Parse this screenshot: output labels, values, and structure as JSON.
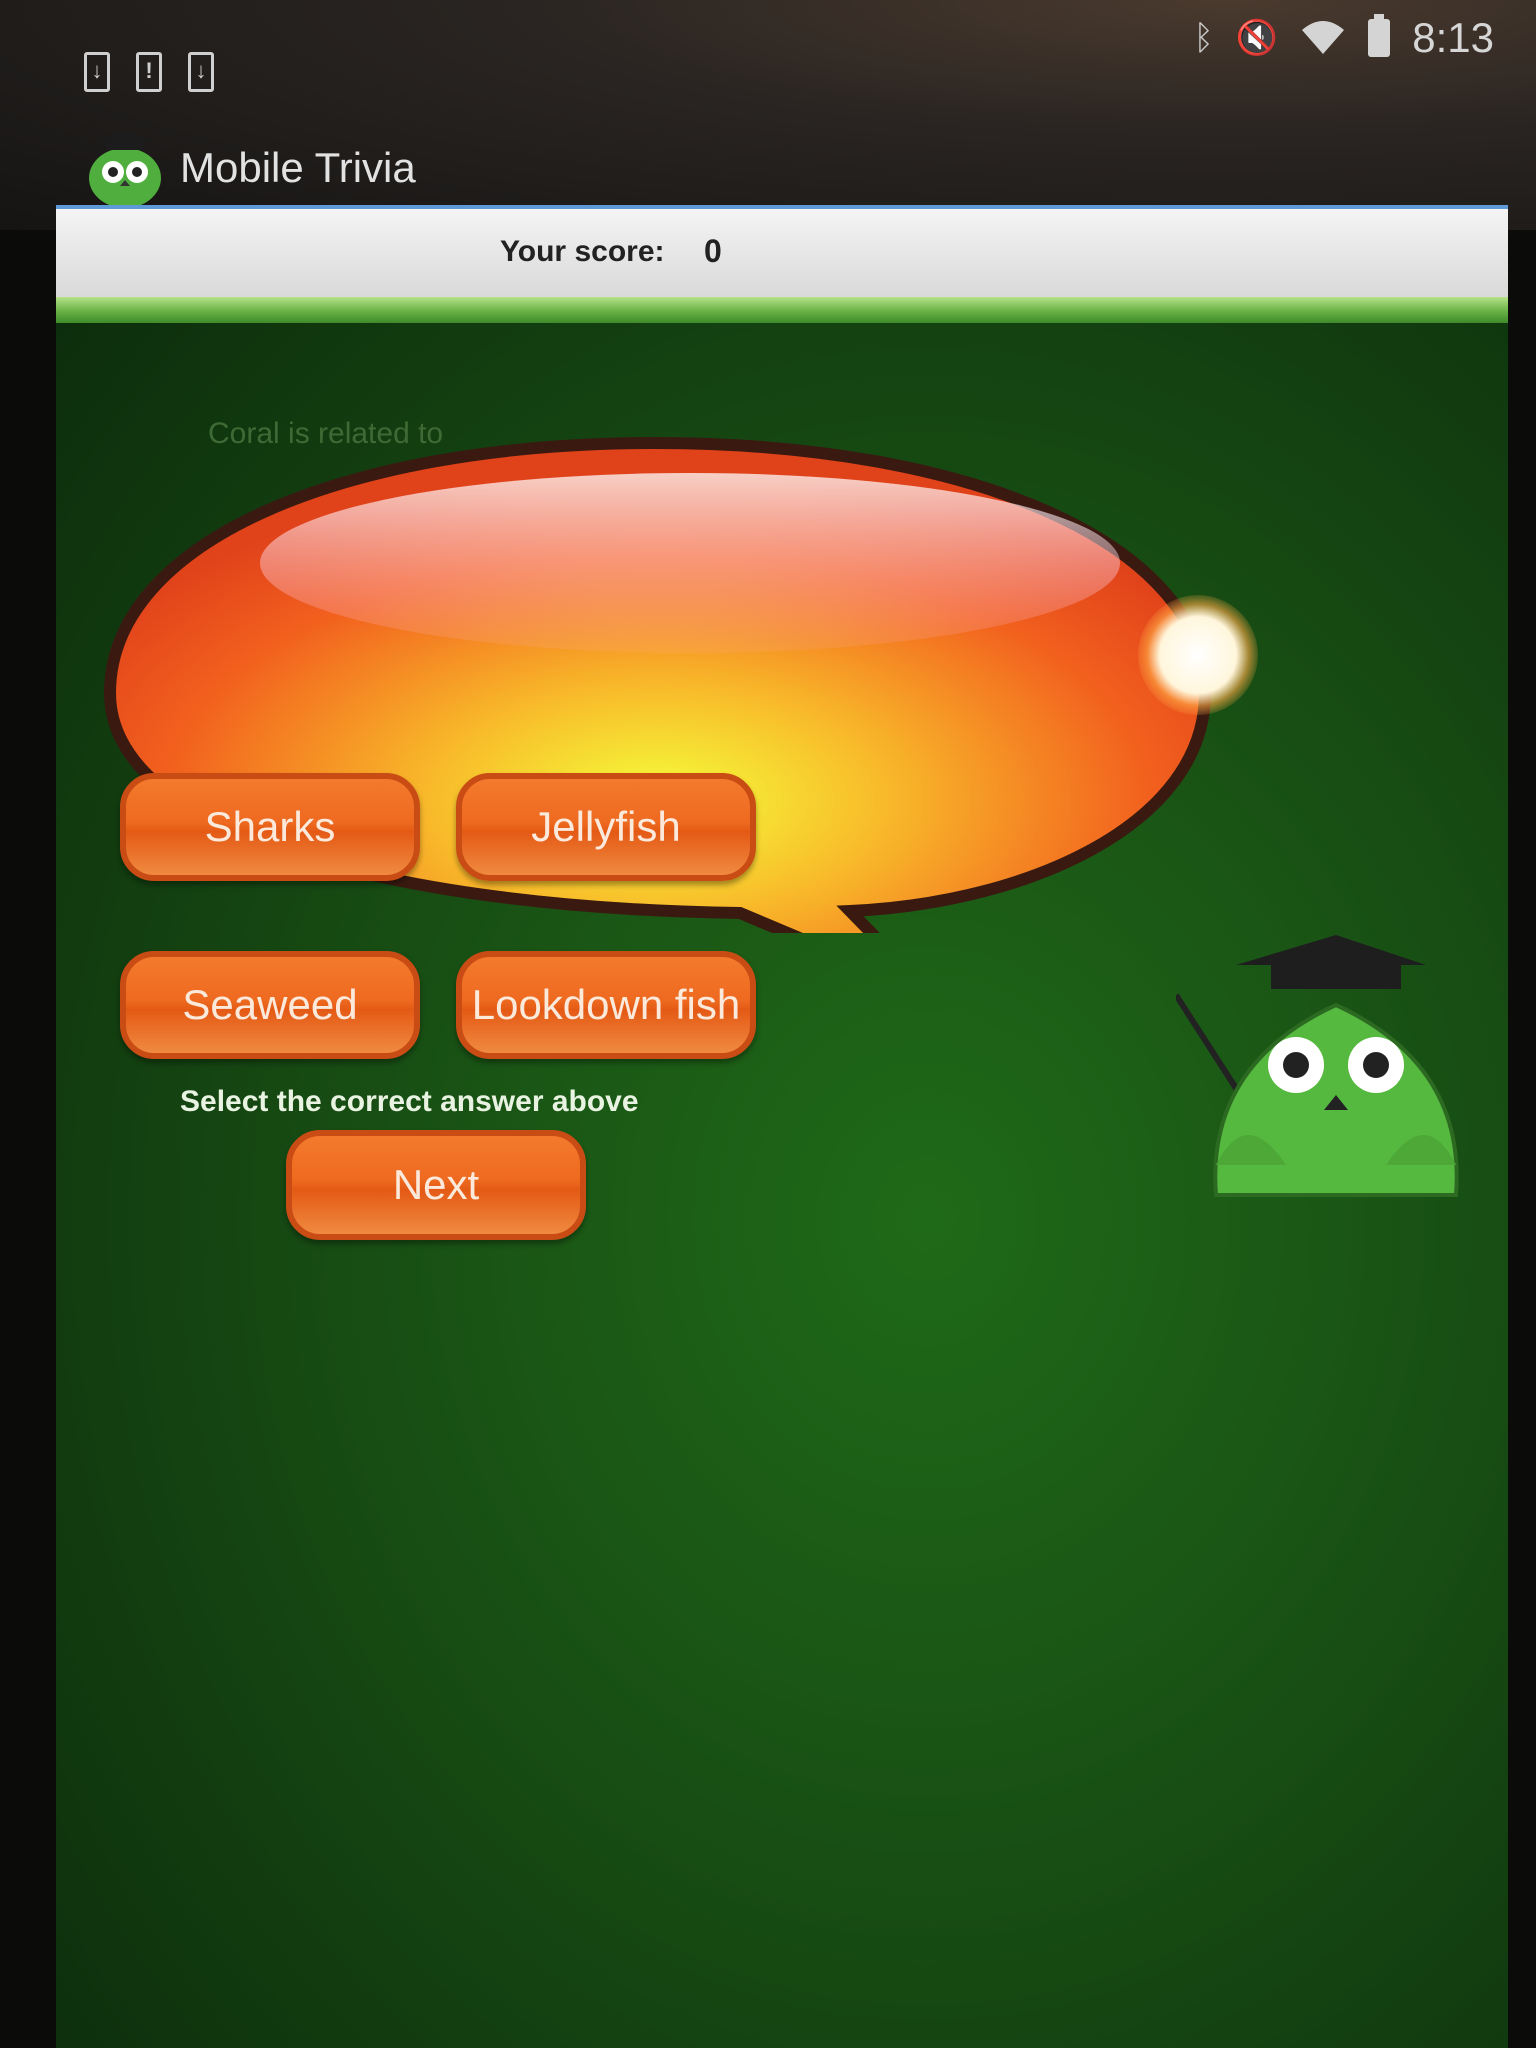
{
  "status_bar": {
    "notification_icons": [
      "download-icon",
      "alert-icon",
      "download-icon"
    ],
    "icons": [
      "bluetooth-icon",
      "mute-icon",
      "wifi-icon",
      "battery-icon"
    ],
    "time": "8:13"
  },
  "app_bar": {
    "title": "Mobile Trivia",
    "logo_icon": "owl-logo-icon"
  },
  "score": {
    "label": "Your score:",
    "value": "0"
  },
  "question": {
    "text": "Coral is related to"
  },
  "answers": [
    {
      "label": "Sharks"
    },
    {
      "label": "Jellyfish"
    },
    {
      "label": "Seaweed"
    },
    {
      "label": "Lookdown fish"
    }
  ],
  "hint": "Select the correct answer above",
  "next_label": "Next",
  "mascot_icon": "owl-mascot-icon",
  "colors": {
    "button_orange": "#ee6a20",
    "background_green": "#1a5515",
    "score_bar": "#e8e8e8"
  }
}
